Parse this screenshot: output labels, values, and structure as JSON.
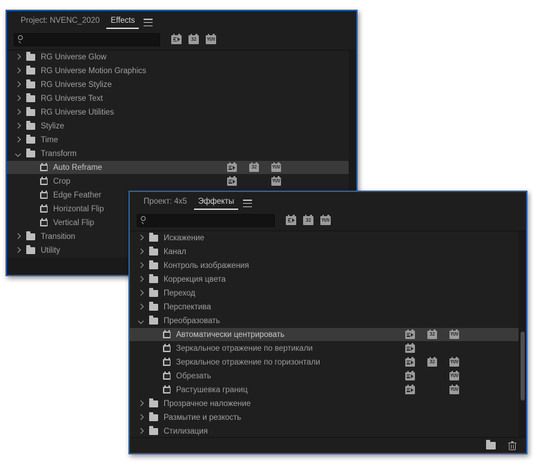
{
  "panels": {
    "english": {
      "project_tab": "Project: NVENC_2020",
      "effects_tab": "Effects",
      "menu_icon": "hamburger-menu-icon",
      "search_value": "",
      "search_placeholder": "",
      "filter_buttons": [
        {
          "name": "accelerated-effects-filter",
          "label": ""
        },
        {
          "name": "32bit-color-filter",
          "label": "32"
        },
        {
          "name": "yuv-color-filter",
          "label": "YUV"
        }
      ],
      "tree": [
        {
          "label": "RG Universe Glow",
          "type": "folder",
          "state": "closed",
          "indent": 0,
          "badges": []
        },
        {
          "label": "RG Universe Motion Graphics",
          "type": "folder",
          "state": "closed",
          "indent": 0,
          "badges": []
        },
        {
          "label": "RG Universe Stylize",
          "type": "folder",
          "state": "closed",
          "indent": 0,
          "badges": []
        },
        {
          "label": "RG Universe Text",
          "type": "folder",
          "state": "closed",
          "indent": 0,
          "badges": []
        },
        {
          "label": "RG Universe Utilities",
          "type": "folder",
          "state": "closed",
          "indent": 0,
          "badges": []
        },
        {
          "label": "Stylize",
          "type": "folder",
          "state": "closed",
          "indent": 0,
          "badges": []
        },
        {
          "label": "Time",
          "type": "folder",
          "state": "closed",
          "indent": 0,
          "badges": []
        },
        {
          "label": "Transform",
          "type": "folder",
          "state": "open",
          "indent": 0,
          "badges": []
        },
        {
          "label": "Auto Reframe",
          "type": "effect",
          "state": "none",
          "indent": 1,
          "selected": true,
          "badges": [
            "accel",
            "32",
            "YUV"
          ]
        },
        {
          "label": "Crop",
          "type": "effect",
          "state": "none",
          "indent": 1,
          "badges": [
            "accel",
            "",
            "YUV"
          ]
        },
        {
          "label": "Edge Feather",
          "type": "effect",
          "state": "none",
          "indent": 1,
          "badges": []
        },
        {
          "label": "Horizontal Flip",
          "type": "effect",
          "state": "none",
          "indent": 1,
          "badges": []
        },
        {
          "label": "Vertical Flip",
          "type": "effect",
          "state": "none",
          "indent": 1,
          "badges": []
        },
        {
          "label": "Transition",
          "type": "folder",
          "state": "closed",
          "indent": 0,
          "badges": []
        },
        {
          "label": "Utility",
          "type": "folder",
          "state": "closed",
          "indent": 0,
          "badges": []
        }
      ]
    },
    "russian": {
      "project_tab": "Проект: 4x5",
      "effects_tab": "Эффекты",
      "menu_icon": "hamburger-menu-icon",
      "search_value": "",
      "search_placeholder": "",
      "filter_buttons": [
        {
          "name": "accelerated-effects-filter",
          "label": ""
        },
        {
          "name": "32bit-color-filter",
          "label": "32"
        },
        {
          "name": "yuv-color-filter",
          "label": "YUV"
        }
      ],
      "tree": [
        {
          "label": "Искажение",
          "type": "folder",
          "state": "closed",
          "indent": 0,
          "badges": []
        },
        {
          "label": "Канал",
          "type": "folder",
          "state": "closed",
          "indent": 0,
          "badges": []
        },
        {
          "label": "Контроль изображения",
          "type": "folder",
          "state": "closed",
          "indent": 0,
          "badges": []
        },
        {
          "label": "Коррекция цвета",
          "type": "folder",
          "state": "closed",
          "indent": 0,
          "badges": []
        },
        {
          "label": "Переход",
          "type": "folder",
          "state": "closed",
          "indent": 0,
          "badges": []
        },
        {
          "label": "Перспектива",
          "type": "folder",
          "state": "closed",
          "indent": 0,
          "badges": []
        },
        {
          "label": "Преобразовать",
          "type": "folder",
          "state": "open",
          "indent": 0,
          "badges": []
        },
        {
          "label": "Автоматически центрировать",
          "type": "effect",
          "state": "none",
          "indent": 1,
          "selected": true,
          "badges": [
            "accel",
            "32",
            "YUV"
          ]
        },
        {
          "label": "Зеркальное отражение по вертикали",
          "type": "effect",
          "state": "none",
          "indent": 1,
          "badges": [
            "accel",
            "",
            ""
          ]
        },
        {
          "label": "Зеркальное отражение по горизонтали",
          "type": "effect",
          "state": "none",
          "indent": 1,
          "badges": [
            "accel",
            "32",
            "YUV"
          ]
        },
        {
          "label": "Обрезать",
          "type": "effect",
          "state": "none",
          "indent": 1,
          "badges": [
            "accel",
            "",
            "YUV"
          ]
        },
        {
          "label": "Растушевка границ",
          "type": "effect",
          "state": "none",
          "indent": 1,
          "badges": [
            "accel",
            "",
            "YUV"
          ]
        },
        {
          "label": "Прозрачное наложение",
          "type": "folder",
          "state": "closed",
          "indent": 0,
          "badges": []
        },
        {
          "label": "Размытие и резкость",
          "type": "folder",
          "state": "closed",
          "indent": 0,
          "badges": []
        },
        {
          "label": "Стилизация",
          "type": "folder",
          "state": "closed",
          "indent": 0,
          "badges": []
        }
      ],
      "footer": {
        "new_bin_icon": "folder-icon",
        "delete_icon": "trash-icon"
      }
    }
  },
  "colors": {
    "panel_border": "#2a5fa8",
    "panel_bg": "#1e1e1e",
    "tree_bg": "#1f1f1f",
    "selected_row": "#3a3a3a",
    "text": "#a0a0a0",
    "badge": "#9b9b9b"
  }
}
